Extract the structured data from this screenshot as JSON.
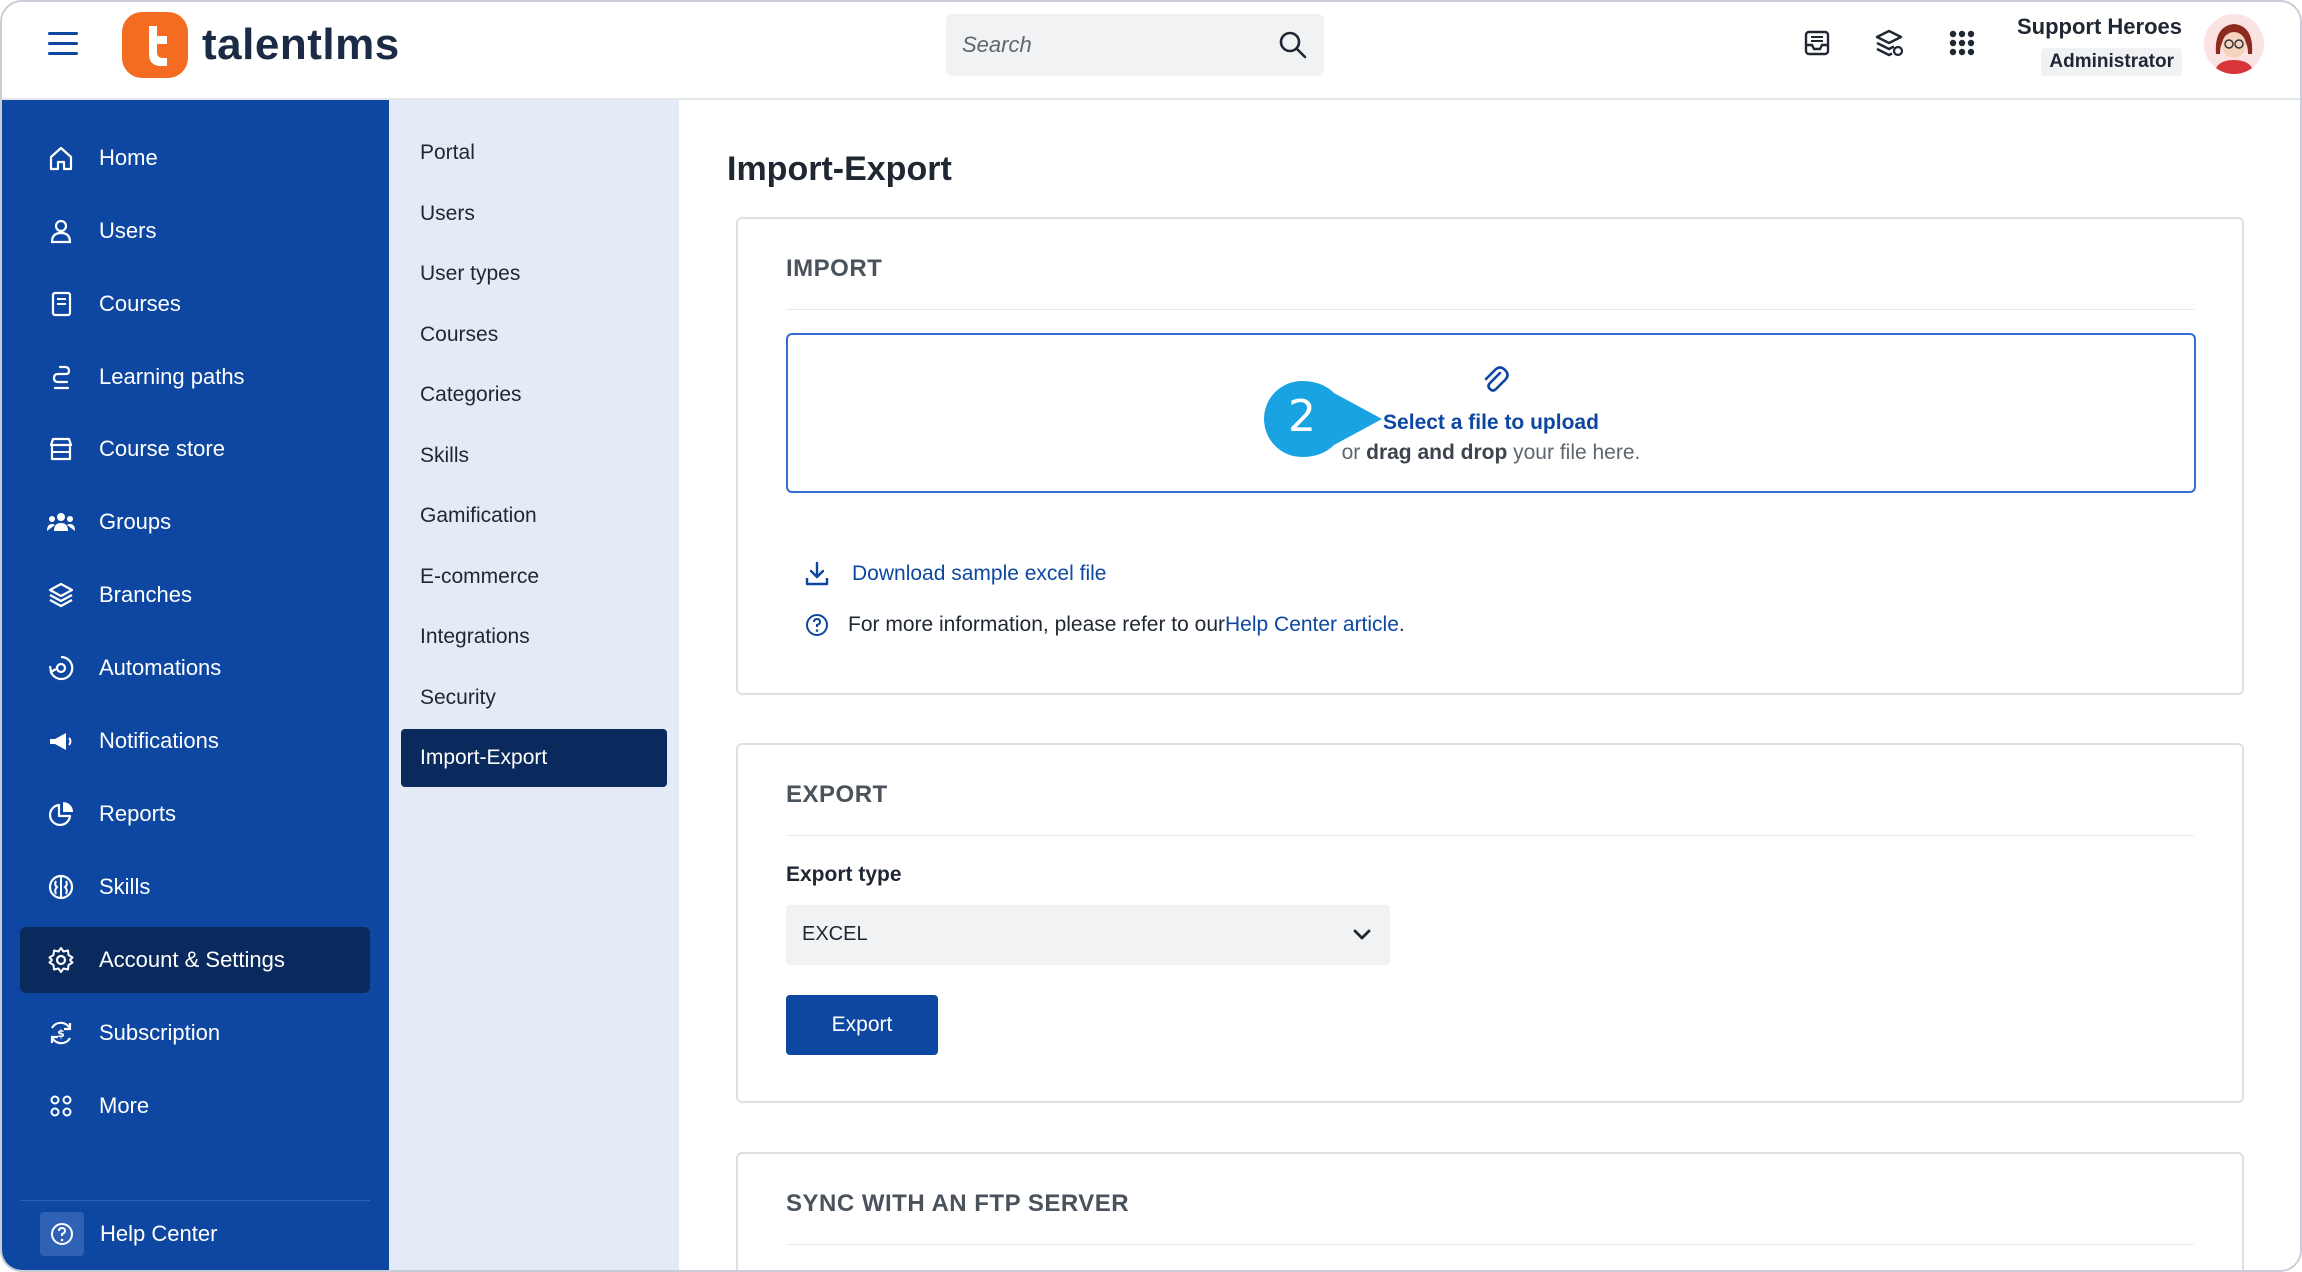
{
  "brand": {
    "name": "talentlms",
    "logo_letter": "t",
    "accent": "#f36c21",
    "primary": "#0d47a1",
    "active_bg": "#0a2a5e"
  },
  "header": {
    "search_placeholder": "Search",
    "icons": [
      "inbox-icon",
      "catalog-icon",
      "apps-grid-icon"
    ],
    "user_name": "Support Heroes",
    "user_role": "Administrator"
  },
  "sidebar": {
    "items": [
      {
        "label": "Home",
        "icon": "home-icon"
      },
      {
        "label": "Users",
        "icon": "user-icon"
      },
      {
        "label": "Courses",
        "icon": "book-icon"
      },
      {
        "label": "Learning paths",
        "icon": "path-icon"
      },
      {
        "label": "Course store",
        "icon": "store-icon"
      },
      {
        "label": "Groups",
        "icon": "groups-icon"
      },
      {
        "label": "Branches",
        "icon": "layers-icon"
      },
      {
        "label": "Automations",
        "icon": "automation-icon"
      },
      {
        "label": "Notifications",
        "icon": "megaphone-icon"
      },
      {
        "label": "Reports",
        "icon": "pie-chart-icon"
      },
      {
        "label": "Skills",
        "icon": "brain-icon"
      },
      {
        "label": "Account & Settings",
        "icon": "gear-icon",
        "active": true
      },
      {
        "label": "Subscription",
        "icon": "subscription-icon"
      },
      {
        "label": "More",
        "icon": "more-icon"
      }
    ],
    "help_center": "Help Center"
  },
  "submenu": {
    "items": [
      "Portal",
      "Users",
      "User types",
      "Courses",
      "Categories",
      "Skills",
      "Gamification",
      "E-commerce",
      "Integrations",
      "Security",
      "Import-Export"
    ],
    "active": "Import-Export"
  },
  "main": {
    "title": "Import-Export",
    "import": {
      "heading": "IMPORT",
      "step_badge": "2",
      "upload_link": "Select a file to upload",
      "upload_sub_prefix": "or ",
      "upload_sub_bold": "drag and drop",
      "upload_sub_suffix": " your file here.",
      "download_link": "Download sample excel file",
      "info_text": "For more information, please refer to our ",
      "help_link": "Help Center article",
      "info_end": "."
    },
    "export": {
      "heading": "EXPORT",
      "type_label": "Export type",
      "type_value": "EXCEL",
      "button": "Export"
    },
    "ftp": {
      "heading": "SYNC WITH AN FTP SERVER"
    }
  }
}
